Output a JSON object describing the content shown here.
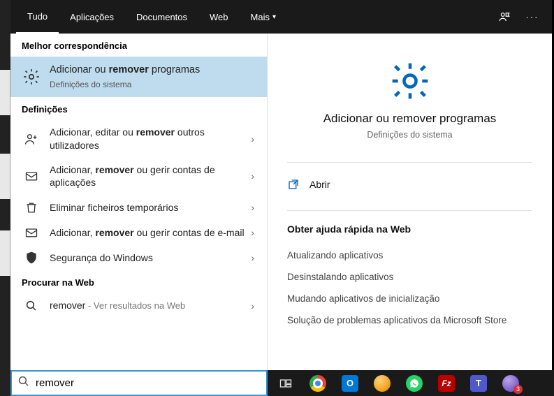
{
  "tabs": {
    "items": [
      "Tudo",
      "Aplicações",
      "Documentos",
      "Web",
      "Mais"
    ],
    "activeIndex": 0
  },
  "sections": {
    "bestMatch": "Melhor correspondência",
    "settings": "Definições",
    "searchWeb": "Procurar na Web"
  },
  "best": {
    "title_pre": "Adicionar ou ",
    "title_bold": "remover",
    "title_post": " programas",
    "subtitle": "Definições do sistema"
  },
  "results": [
    {
      "icon": "user-add",
      "pre": "Adicionar, editar ou ",
      "bold": "remover",
      "post": " outros utilizadores"
    },
    {
      "icon": "mail",
      "pre": "Adicionar, ",
      "bold": "remover",
      "post": " ou gerir contas de aplicações"
    },
    {
      "icon": "trash",
      "pre": "Eliminar ficheiros temporários",
      "bold": "",
      "post": ""
    },
    {
      "icon": "mail",
      "pre": "Adicionar, ",
      "bold": "remover",
      "post": " ou gerir contas de e-mail"
    },
    {
      "icon": "shield",
      "pre": "Segurança do Windows",
      "bold": "",
      "post": ""
    }
  ],
  "webResult": {
    "term": "remover",
    "suffix": " - Ver resultados na Web"
  },
  "detail": {
    "title": "Adicionar ou remover programas",
    "subtitle": "Definições do sistema",
    "open": "Abrir",
    "helpTitle": "Obter ajuda rápida na Web",
    "helpLinks": [
      "Atualizando aplicativos",
      "Desinstalando aplicativos",
      "Mudando aplicativos de inicialização",
      "Solução de problemas aplicativos da Microsoft Store"
    ]
  },
  "search": {
    "value": "remover",
    "placeholder": ""
  },
  "taskbar": {
    "apps": [
      {
        "name": "task-view",
        "shape": "taskview"
      },
      {
        "name": "chrome",
        "shape": "chrome"
      },
      {
        "name": "outlook",
        "shape": "outlook"
      },
      {
        "name": "app-orange",
        "shape": "circle-orange"
      },
      {
        "name": "whatsapp",
        "shape": "whatsapp"
      },
      {
        "name": "filezilla",
        "shape": "filezilla"
      },
      {
        "name": "teams",
        "shape": "teams"
      },
      {
        "name": "app-purple",
        "shape": "circle-purple",
        "badge": "3"
      }
    ]
  }
}
